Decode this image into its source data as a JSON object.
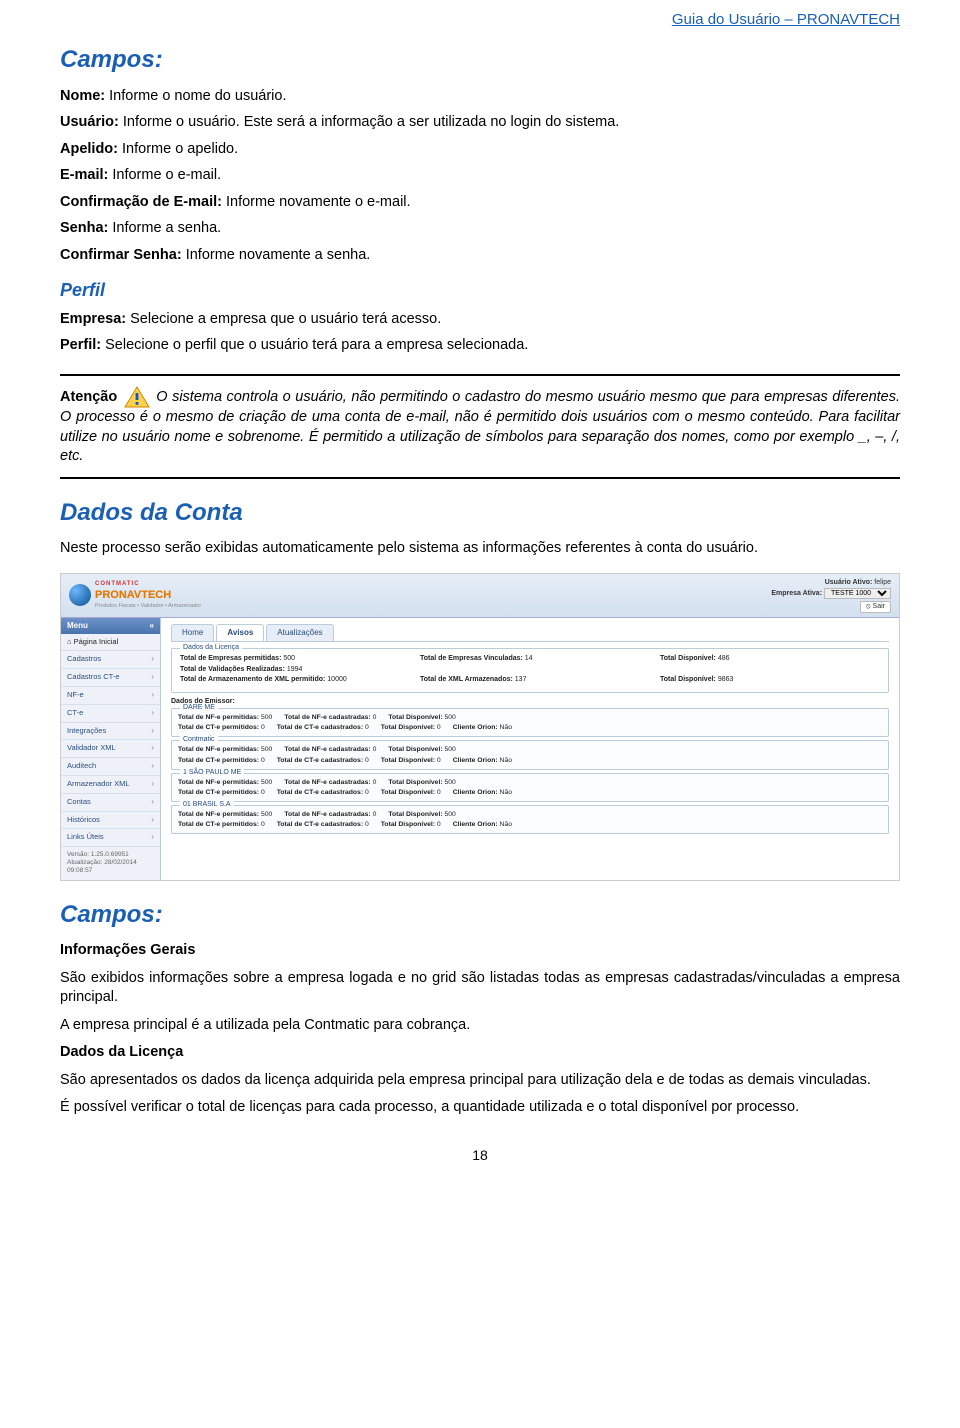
{
  "header_link": "Guia do Usuário – PRONAVTECH",
  "campos1": {
    "heading": "Campos:",
    "lines": [
      {
        "label": "Nome:",
        "text": " Informe o nome do usuário."
      },
      {
        "label": "Usuário:",
        "text": " Informe o usuário. Este será a informação a ser utilizada no login do sistema."
      },
      {
        "label": "Apelido:",
        "text": " Informe o apelido."
      },
      {
        "label": "E-mail:",
        "text": " Informe o e-mail."
      },
      {
        "label": "Confirmação de E-mail:",
        "text": " Informe novamente o e-mail."
      },
      {
        "label": "Senha:",
        "text": " Informe a senha."
      },
      {
        "label": "Confirmar Senha:",
        "text": " Informe novamente a senha."
      }
    ],
    "perfil_heading": "Perfil",
    "perfil_lines": [
      {
        "label": "Empresa:",
        "text": " Selecione a empresa que o usuário terá acesso."
      },
      {
        "label": "Perfil:",
        "text": " Selecione o perfil que o usuário terá para a empresa selecionada."
      }
    ]
  },
  "attention": {
    "label": "Atenção",
    "text": " O sistema controla o usuário, não permitindo o cadastro do mesmo usuário mesmo que para empresas diferentes. O processo é o mesmo de criação de uma conta de e-mail, não é permitido dois usuários com o mesmo conteúdo. Para facilitar utilize no usuário nome e sobrenome. É permitido a utilização de símbolos para separação dos nomes, como por exemplo _, –, /, etc."
  },
  "dados_conta": {
    "heading": "Dados da Conta",
    "text": "Neste processo serão exibidas automaticamente pelo sistema as informações referentes à conta do usuário."
  },
  "app": {
    "logo": {
      "brand_small": "CONTMATIC",
      "brand": "PRONAVTECH",
      "tagline": "Produtos Fiscais • Validador • Armazenador"
    },
    "user": {
      "label": "Usuário Ativo:",
      "value": "felipe",
      "empresa_label": "Empresa Ativa:",
      "empresa_value": "TESTE 1000",
      "sair": "Sair"
    },
    "menu": {
      "title": "Menu",
      "items": [
        "Página Inicial",
        "Cadastros",
        "Cadastros CT-e",
        "NF-e",
        "CT-e",
        "Integrações",
        "Validador XML",
        "Auditech",
        "Armazenador XML",
        "Contas",
        "Históricos",
        "Links Úteis"
      ],
      "version": "Versão: 1.25.0.69951",
      "updated": "Atualização: 28/02/2014 09:08:57"
    },
    "tabs": [
      "Home",
      "Avisos",
      "Atualizações"
    ],
    "active_tab": "Avisos",
    "license": {
      "legend": "Dados da Licença",
      "summary": [
        [
          {
            "l": "Total de Empresas permitidas:",
            "v": "500"
          },
          {
            "l": "Total de Empresas Vinculadas:",
            "v": "14"
          },
          {
            "l": "Total Disponível:",
            "v": "486"
          }
        ],
        [
          {
            "l": "Total de Validações Realizadas:",
            "v": "1994"
          }
        ],
        [
          {
            "l": "Total de Armazenamento de XML permitido:",
            "v": "10000"
          },
          {
            "l": "Total de XML Armazenados:",
            "v": "137"
          },
          {
            "l": "Total Disponível:",
            "v": "9863"
          }
        ]
      ],
      "emissor_header": "Dados do Emissor:",
      "emissors": [
        {
          "name": "DARE ME"
        },
        {
          "name": "Contmatic"
        },
        {
          "name": "1 SÃO PAULO ME"
        },
        {
          "name": "01 BRASIL S.A"
        }
      ],
      "emissor_rows": [
        [
          {
            "l": "Total de NF-e permitidas:",
            "v": "500"
          },
          {
            "l": "Total de NF-e cadastradas:",
            "v": "0"
          },
          {
            "l": "Total Disponível:",
            "v": "500"
          }
        ],
        [
          {
            "l": "Total de CT-e permitidos:",
            "v": "0"
          },
          {
            "l": "Total de CT-e cadastrados:",
            "v": "0"
          },
          {
            "l": "Total Disponível:",
            "v": "0"
          },
          {
            "l": "Cliente Orion:",
            "v": "Não"
          }
        ]
      ]
    }
  },
  "campos2": {
    "heading": "Campos:",
    "sub1": "Informações Gerais",
    "p1": "São exibidos informações sobre a empresa logada e no grid são listadas todas as empresas cadastradas/vinculadas a empresa principal.",
    "p2": "A empresa principal é a utilizada pela Contmatic para cobrança.",
    "sub2": "Dados da Licença",
    "p3": "São apresentados os dados da licença adquirida pela empresa principal para utilização dela e de todas as demais vinculadas.",
    "p4": "É possível verificar o total de licenças para cada processo, a quantidade utilizada e o total disponível por processo."
  },
  "page_number": "18"
}
